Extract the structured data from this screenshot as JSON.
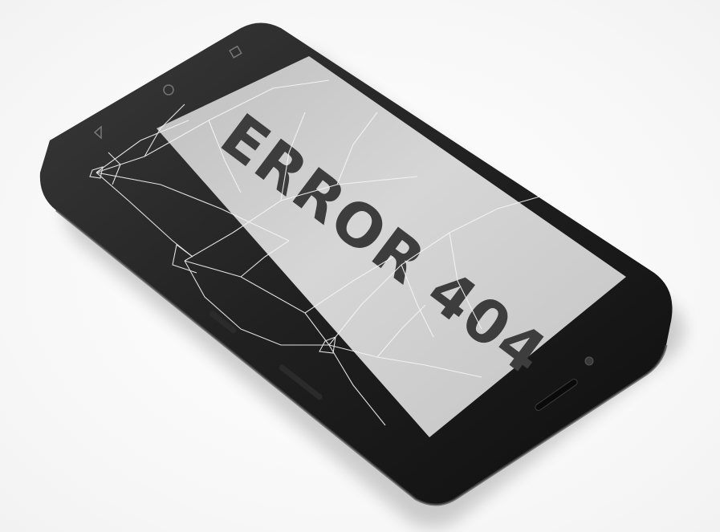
{
  "screen": {
    "message": "ERROR 404"
  },
  "colors": {
    "background": "#ffffff",
    "phone_body": "#1f1f1f",
    "bezel": "#151515",
    "screen": "#cfcfcf",
    "text": "#3d3d3d",
    "cracks": "#f4f4f4"
  },
  "icons": [
    "back-triangle-icon",
    "home-circle-icon",
    "recent-square-icon",
    "speaker-grille-icon",
    "front-camera-icon"
  ]
}
